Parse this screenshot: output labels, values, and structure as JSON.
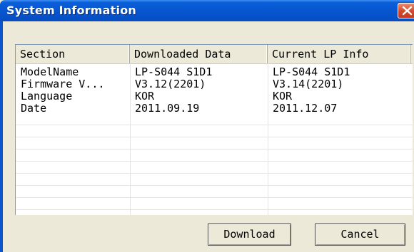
{
  "window": {
    "title": "System Information"
  },
  "table": {
    "headers": [
      "Section",
      "Downloaded Data",
      "Current LP Info"
    ],
    "rows": [
      [
        "ModelName",
        "LP-S044 S1D1",
        "LP-S044 S1D1"
      ],
      [
        "Firmware V...",
        "V3.12(2201)",
        "V3.14(2201)"
      ],
      [
        "Language",
        "KOR",
        "KOR"
      ],
      [
        "Date",
        "2011.09.19",
        "2011.12.07"
      ]
    ]
  },
  "buttons": {
    "download": "Download",
    "cancel": "Cancel"
  },
  "colors": {
    "titlebar": "#0756d0",
    "close": "#d4462a",
    "face": "#ece9d8"
  },
  "icons": {
    "close": "close-icon"
  }
}
